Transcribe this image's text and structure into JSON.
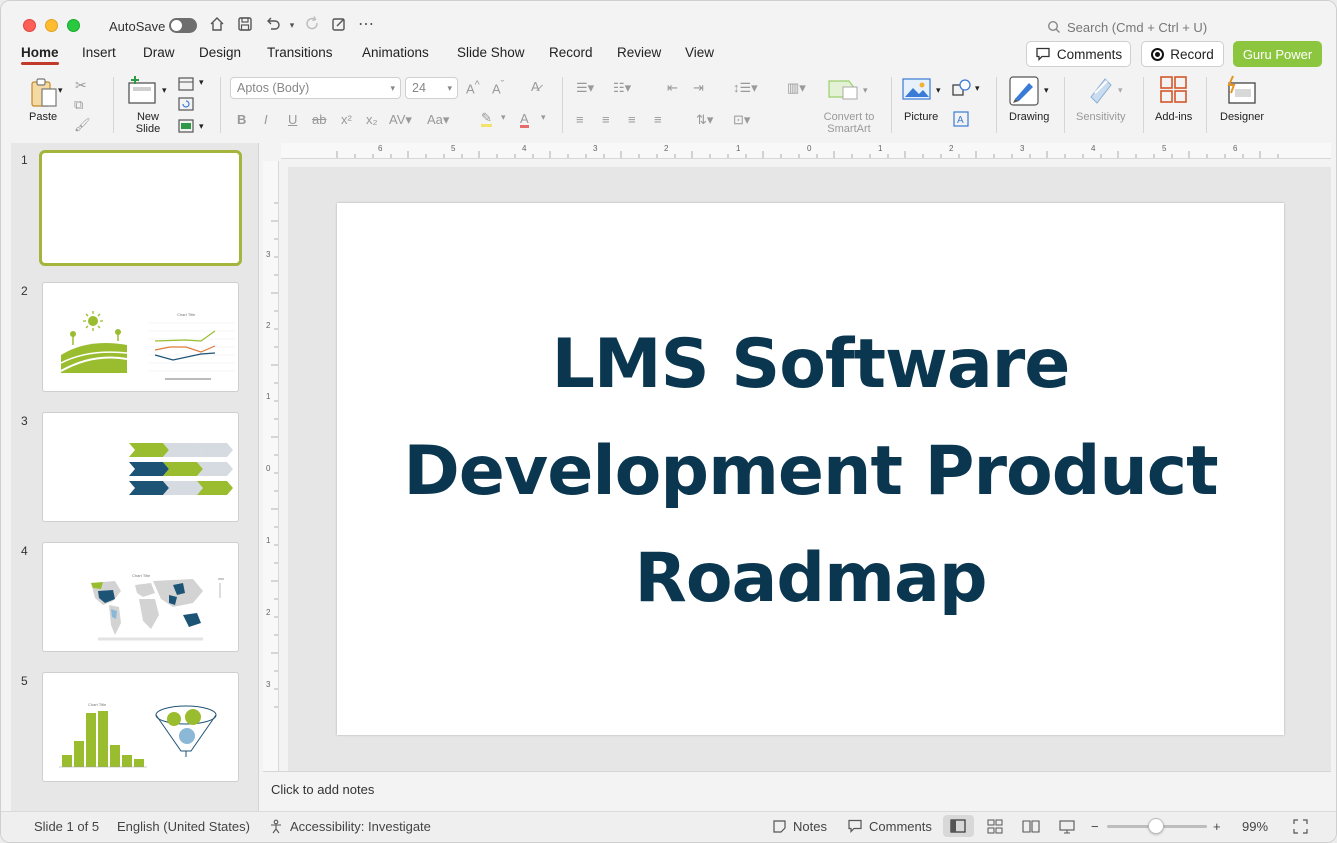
{
  "titlebar": {
    "autosave_label": "AutoSave",
    "search_placeholder": "Search (Cmd + Ctrl + U)"
  },
  "tabs": [
    "Home",
    "Insert",
    "Draw",
    "Design",
    "Transitions",
    "Animations",
    "Slide Show",
    "Record",
    "Review",
    "View"
  ],
  "actions": {
    "comments": "Comments",
    "record": "Record",
    "guru_power": "Guru Power"
  },
  "ribbon": {
    "paste": "Paste",
    "new_slide": "New Slide",
    "font_name": "Aptos (Body)",
    "font_size": "24",
    "convert_smartart": "Convert to SmartArt",
    "picture": "Picture",
    "drawing": "Drawing",
    "sensitivity": "Sensitivity",
    "addins": "Add-ins",
    "designer": "Designer"
  },
  "slides_panel": {
    "numbers": [
      "1",
      "2",
      "3",
      "4",
      "5"
    ],
    "chart_title": "Chart Title"
  },
  "slide": {
    "title_lines": [
      "LMS Software",
      "Development Product",
      "Roadmap"
    ]
  },
  "notes": {
    "placeholder": "Click to add notes"
  },
  "statusbar": {
    "slide_position": "Slide 1 of 5",
    "language": "English (United States)",
    "accessibility": "Accessibility: Investigate",
    "notes": "Notes",
    "comments": "Comments",
    "zoom": "99%"
  },
  "colors": {
    "accent_red": "#c0392b",
    "guru_green": "#8cc63f",
    "title_navy": "#0b3650",
    "thumb_selected": "#a5b43a"
  }
}
